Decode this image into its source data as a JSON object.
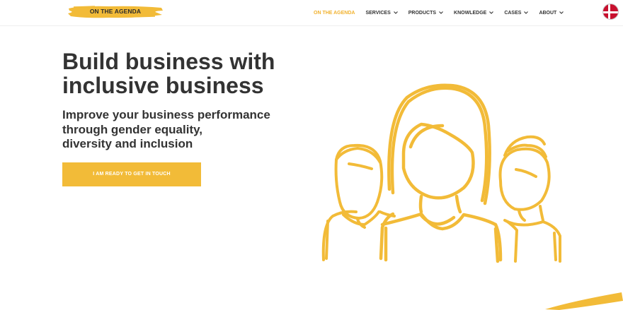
{
  "header": {
    "logo_text": "ON THE AGENDA",
    "nav": [
      {
        "label": "ON THE AGENDA",
        "active": true,
        "dropdown": false
      },
      {
        "label": "SERVICES",
        "active": false,
        "dropdown": true
      },
      {
        "label": "PRODUCTS",
        "active": false,
        "dropdown": true
      },
      {
        "label": "KNOWLEDGE",
        "active": false,
        "dropdown": true
      },
      {
        "label": "CASES",
        "active": false,
        "dropdown": true
      },
      {
        "label": "ABOUT",
        "active": false,
        "dropdown": true
      }
    ],
    "language_flag": "denmark-flag-icon"
  },
  "hero": {
    "title_line1": "Build business with",
    "title_line2": "inclusive business",
    "subtitle_line1": "Improve your business performance",
    "subtitle_line2": "through gender equality,",
    "subtitle_line3": "diversity and inclusion",
    "cta_label": "I AM READY TO GET IN TOUCH"
  },
  "colors": {
    "accent": "#f2bb38",
    "text": "#333333",
    "nav_active": "#f1b22f"
  },
  "icons": [
    "chevron-down-icon",
    "people-illustration",
    "denmark-flag-icon"
  ]
}
